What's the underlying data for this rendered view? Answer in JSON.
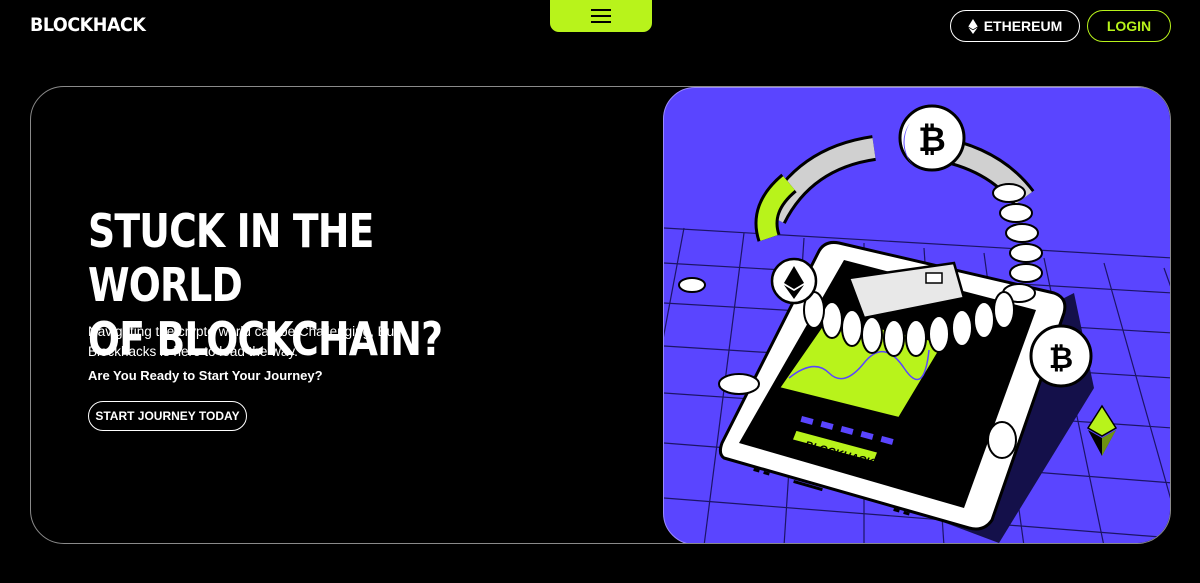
{
  "header": {
    "brand": "BLOCKHACK",
    "menu_icon": "hamburger-menu-icon",
    "network_label": "ETHEREUM",
    "network_icon": "ethereum-icon",
    "login_label": "LOGIN"
  },
  "hero": {
    "title_line1": "STUCK IN THE WORLD",
    "title_line2": "OF BLOCKCHAIN?",
    "description": "Navigating the crypto world can be Challenging, But Blockhacks is here to lead the way.",
    "question": "Are You Ready to Start Your Journey?",
    "cta_label": "START JOURNEY TODAY"
  },
  "illustration": {
    "screen_label": "BLOCKHACK",
    "icons": [
      "bitcoin-coin-icon",
      "ethereum-coin-icon",
      "ethereum-crystal-icon",
      "credit-card-icon"
    ]
  },
  "colors": {
    "accent": "#b8f31b",
    "illustration_bg": "#5a45ff",
    "background": "#000000"
  }
}
